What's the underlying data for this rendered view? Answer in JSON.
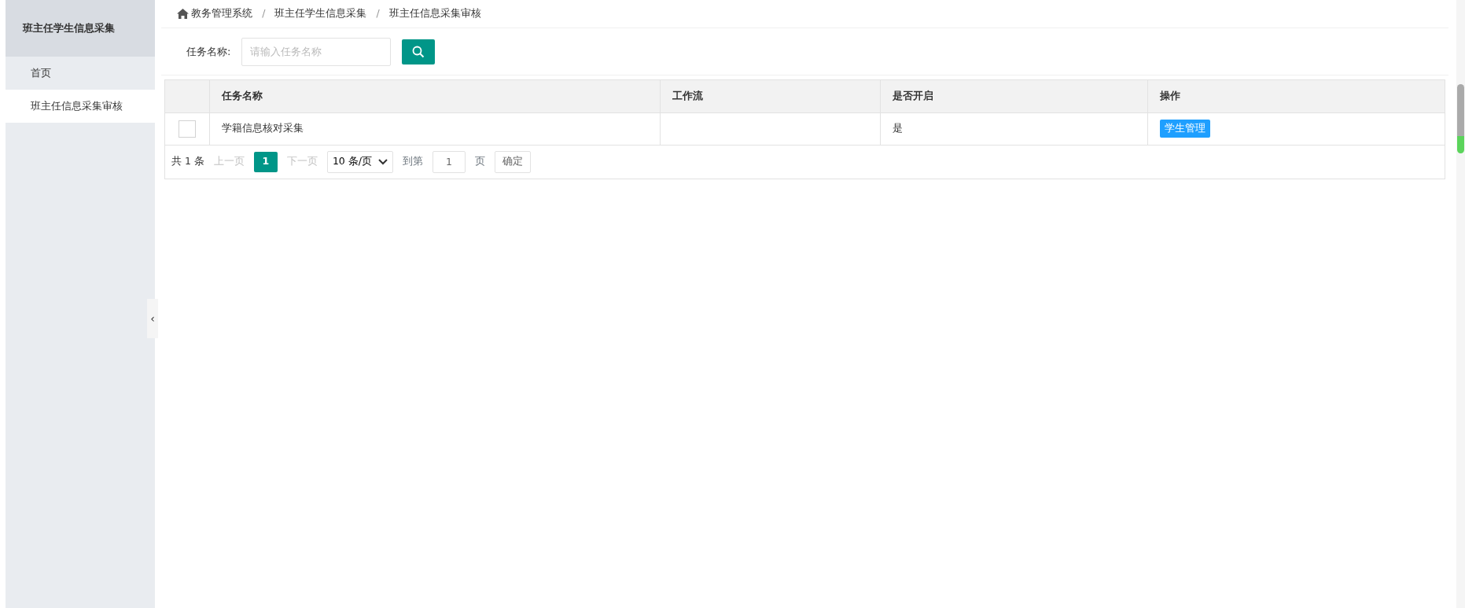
{
  "sidebar": {
    "title": "班主任学生信息采集",
    "items": [
      {
        "label": "首页",
        "selected": false
      },
      {
        "label": "班主任信息采集审核",
        "selected": true
      }
    ],
    "collapse_glyph": "‹"
  },
  "breadcrumb": [
    "教务管理系统",
    "班主任学生信息采集",
    "班主任信息采集审核"
  ],
  "breadcrumb_separator": "/",
  "search": {
    "label": "任务名称:",
    "placeholder": "请输入任务名称"
  },
  "table": {
    "columns": [
      "任务名称",
      "工作流",
      "是否开启",
      "操作"
    ],
    "rows": [
      {
        "checked": false,
        "name": "学籍信息核对采集",
        "open": "是",
        "action": "学生管理"
      }
    ]
  },
  "pager": {
    "total": "共 1 条",
    "prev": "上一页",
    "pages": [
      {
        "label": "1",
        "selected": true
      }
    ],
    "next": "下一页",
    "page_size": "10 条/页",
    "goto_label": "到第",
    "goto_value": "1",
    "page_unit": "页",
    "confirm": "确定"
  }
}
